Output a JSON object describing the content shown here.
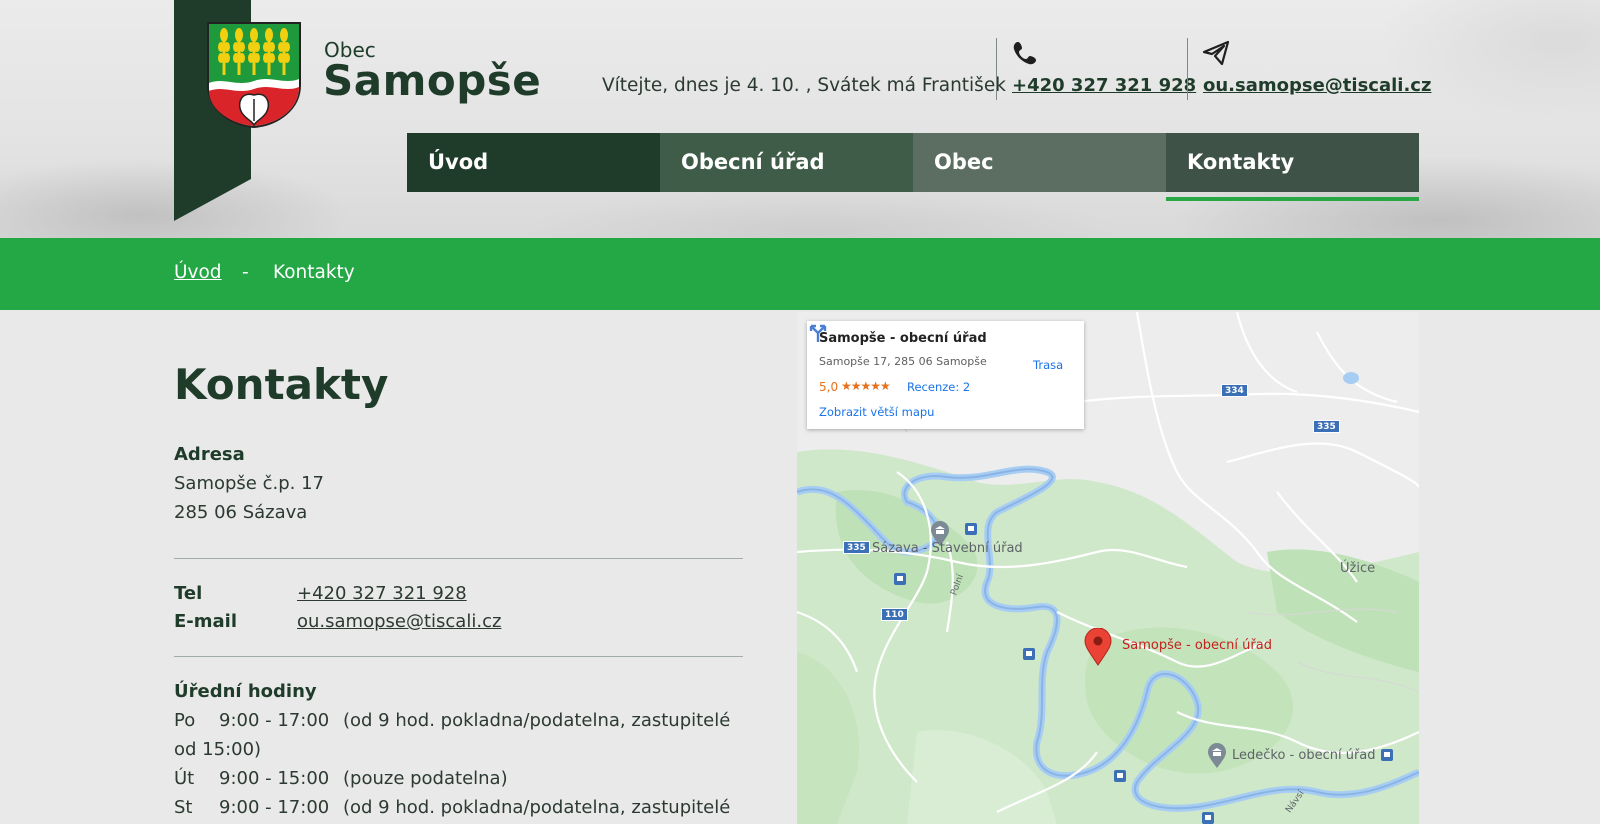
{
  "brand": {
    "small": "Obec",
    "big": "Samopše"
  },
  "header": {
    "welcome": "Vítejte, dnes je 4. 10. , Svátek má František",
    "phone": "+420 327 321 928",
    "email": "ou.samopse@tiscali.cz"
  },
  "nav": [
    {
      "label": "Úvod"
    },
    {
      "label": "Obecní úřad"
    },
    {
      "label": "Obec"
    },
    {
      "label": "Kontakty"
    }
  ],
  "breadcrumb": {
    "home": "Úvod",
    "separator": "-",
    "current": "Kontakty"
  },
  "content": {
    "title": "Kontakty",
    "address_label": "Adresa",
    "address_line1": "Samopše č.p. 17",
    "address_line2": "285 06 Sázava",
    "tel_label": "Tel",
    "tel_value": "+420 327 321 928",
    "email_label": "E-mail",
    "email_value": "ou.samopse@tiscali.cz",
    "hours_title": "Úřední hodiny",
    "hours": [
      {
        "day": "Po",
        "time": "9:00 - 17:00",
        "note": "(od 9 hod. pokladna/podatelna, zastupitelé",
        "note2": "od  15:00)"
      },
      {
        "day": "Út",
        "time": "9:00 - 15:00",
        "note": "(pouze podatelna)"
      },
      {
        "day": "St",
        "time": "9:00 - 17:00",
        "note": "(od 9 hod. pokladna/podatelna, zastupitelé"
      }
    ]
  },
  "map": {
    "card_title": "Samopše - obecní úřad",
    "card_address": "Samopše 17, 285 06 Samopše",
    "rating": "5,0",
    "stars": "★★★★★",
    "reviews": "Recenze: 2",
    "bigger_map": "Zobrazit větší mapu",
    "route": "Trasa",
    "labels": {
      "sazava": "Sázava - Stavební úřad",
      "samopse": "Samopše - obecní úřad",
      "ledecko": "Ledečko - obecní úřad",
      "uzice": "Úžice",
      "polni": "Polní",
      "navsi": "Návsí"
    },
    "roads": {
      "r334": "334",
      "r335a": "335",
      "r335b": "335",
      "r110": "110"
    }
  },
  "colors": {
    "dark_green": "#1f3b2a",
    "accent_green": "#24a745",
    "nav_2": "#3f5c48",
    "nav_3": "#5b6e61",
    "nav_4": "#3f5248"
  }
}
